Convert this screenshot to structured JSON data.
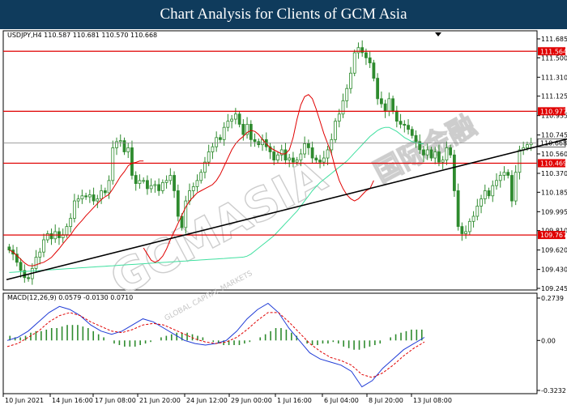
{
  "title": "Chart Analysis for Clients of GCM Asia",
  "watermark": {
    "brand": "GCMASIA",
    "sub": "GLOBAL CAPITAL MARKETS",
    "badge": "国际金融"
  },
  "colors": {
    "header_bg": "#0f3b5c",
    "candle": "#2e8b2e",
    "support_resistance": "#e00000",
    "trendline": "#000000",
    "ma_fast": "#e00000",
    "ma_slow": "#40e0a0",
    "macd_line": "#1f3bd6",
    "macd_signal": "#e00000",
    "macd_hist": "#2e8b2e",
    "current_line": "#808080"
  },
  "chart_data": [
    {
      "type": "candlestick",
      "info": "USDJPY,H4  110.587 110.681 110.570 110.668",
      "ylim": [
        109.245,
        111.685
      ],
      "y_ticks": [
        "111.685",
        "111.500",
        "111.310",
        "111.125",
        "110.935",
        "110.745",
        "110.560",
        "110.370",
        "110.185",
        "109.995",
        "109.810",
        "109.620",
        "109.430",
        "109.245"
      ],
      "x_ticks": [
        "10 Jun 2021",
        "14 Jun 16:00",
        "17 Jun 08:00",
        "21 Jun 20:00",
        "24 Jun 12:00",
        "29 Jun 00:00",
        "1 Jul 16:00",
        "6 Jul 04:00",
        "8 Jul 20:00",
        "13 Jul 08:00"
      ],
      "levels": [
        {
          "label": "111.564",
          "value": 111.564
        },
        {
          "label": "110.977",
          "value": 110.977
        },
        {
          "label": "110.469",
          "value": 110.469
        },
        {
          "label": "109.767",
          "value": 109.767
        }
      ],
      "current_price": {
        "label": "110.668",
        "value": 110.668
      },
      "closes": [
        109.62,
        109.58,
        109.5,
        109.42,
        109.35,
        109.34,
        109.44,
        109.55,
        109.6,
        109.72,
        109.78,
        109.73,
        109.8,
        109.74,
        109.77,
        109.85,
        109.93,
        110.1,
        110.12,
        110.15,
        110.14,
        110.16,
        110.1,
        110.12,
        110.2,
        110.18,
        110.3,
        110.62,
        110.68,
        110.69,
        110.58,
        110.62,
        110.35,
        110.27,
        110.3,
        110.3,
        110.22,
        110.25,
        110.26,
        110.2,
        110.28,
        110.3,
        110.35,
        110.2,
        109.95,
        109.84,
        110.1,
        110.2,
        110.24,
        110.3,
        110.38,
        110.48,
        110.58,
        110.63,
        110.72,
        110.7,
        110.82,
        110.88,
        110.9,
        110.95,
        110.85,
        110.75,
        110.85,
        110.7,
        110.68,
        110.65,
        110.7,
        110.63,
        110.58,
        110.5,
        110.55,
        110.6,
        110.5,
        110.52,
        110.48,
        110.5,
        110.56,
        110.66,
        110.62,
        110.52,
        110.5,
        110.48,
        110.52,
        110.6,
        110.7,
        110.88,
        110.95,
        111.08,
        111.2,
        111.35,
        111.55,
        111.6,
        111.55,
        111.5,
        111.45,
        111.3,
        111.1,
        111.05,
        110.98,
        111.1,
        110.98,
        110.88,
        110.85,
        110.84,
        110.8,
        110.74,
        110.68,
        110.6,
        110.55,
        110.6,
        110.52,
        110.58,
        110.48,
        110.5,
        110.62,
        110.55,
        110.2,
        109.85,
        109.78,
        109.8,
        109.9,
        109.95,
        110.05,
        110.12,
        110.2,
        110.15,
        110.25,
        110.3,
        110.35,
        110.38,
        110.35,
        110.1,
        110.38,
        110.6,
        110.62,
        110.65,
        110.668
      ],
      "ma_fast": [
        109.64,
        109.58,
        109.52,
        109.5,
        109.52,
        109.56,
        109.63,
        109.72,
        109.8,
        109.88,
        109.96,
        110.04,
        110.1,
        110.14,
        110.18,
        110.2,
        110.22,
        110.24,
        110.26,
        110.3,
        110.36,
        110.44,
        110.52,
        110.6,
        110.66,
        110.7,
        110.73,
        110.77,
        110.79,
        110.78,
        110.75,
        110.7,
        110.66,
        110.62,
        110.6,
        110.58,
        110.56,
        110.56,
        110.6,
        110.72,
        110.9,
        111.04,
        111.12,
        111.14,
        111.1,
        111.0,
        110.88,
        110.76,
        110.66,
        110.56,
        110.42,
        110.3,
        110.22,
        110.16,
        110.12,
        110.1,
        110.12,
        110.16,
        110.2,
        110.22,
        110.3
      ],
      "ma_fast_start_index": 35,
      "ma_slow": [
        109.55,
        109.56,
        109.58,
        109.61,
        109.64,
        109.67,
        109.7,
        109.73,
        109.76,
        109.8,
        109.84,
        109.88,
        109.92,
        109.96,
        110.0,
        110.05,
        110.1,
        110.15,
        110.2,
        110.24,
        110.28,
        110.31,
        110.34,
        110.37,
        110.4,
        110.43,
        110.46,
        110.49,
        110.53,
        110.57,
        110.61,
        110.65,
        110.69,
        110.73,
        110.76,
        110.79,
        110.81,
        110.82,
        110.82,
        110.8,
        110.78,
        110.75,
        110.72,
        110.7,
        110.68,
        110.67,
        110.66,
        110.66
      ],
      "ma_slow_start_index": 61,
      "trendline": [
        {
          "x": "10 Jun 2021",
          "y": 109.33
        },
        {
          "x": "13 Jul 08:00",
          "y": 110.57
        }
      ]
    },
    {
      "type": "macd",
      "label": "MACD(12,26,9) 0.0579 -0.0130 0.0710",
      "y_ticks": [
        "0.2739",
        "0.00",
        "-0.3232"
      ],
      "ylim": [
        -0.3232,
        0.2739
      ],
      "histogram": [
        0.03,
        0.02,
        0.02,
        0.03,
        0.05,
        0.06,
        0.06,
        0.07,
        0.08,
        0.08,
        0.09,
        0.1,
        0.1,
        0.1,
        0.09,
        0.08,
        0.06,
        0.04,
        0.02,
        0.0,
        -0.02,
        -0.03,
        -0.04,
        -0.04,
        -0.04,
        -0.03,
        -0.02,
        -0.01,
        0.0,
        0.02,
        0.03,
        0.04,
        0.05,
        0.05,
        0.05,
        0.04,
        0.03,
        0.02,
        0.0,
        -0.01,
        -0.02,
        -0.03,
        -0.03,
        -0.03,
        -0.03,
        -0.02,
        -0.01,
        0.0,
        0.02,
        0.04,
        0.06,
        0.08,
        0.08,
        0.07,
        0.05,
        0.03,
        0.0,
        -0.02,
        -0.03,
        -0.03,
        -0.02,
        -0.02,
        -0.01,
        -0.02,
        -0.04,
        -0.05,
        -0.06,
        -0.06,
        -0.05,
        -0.04,
        -0.03,
        -0.02,
        0.0,
        0.02,
        0.04,
        0.05,
        0.06,
        0.07,
        0.07,
        0.07
      ],
      "macd_line": [
        0.0,
        0.02,
        0.06,
        0.12,
        0.18,
        0.22,
        0.2,
        0.16,
        0.1,
        0.06,
        0.04,
        0.06,
        0.1,
        0.14,
        0.12,
        0.08,
        0.04,
        0.0,
        -0.02,
        -0.03,
        -0.02,
        0.0,
        0.06,
        0.14,
        0.2,
        0.24,
        0.18,
        0.08,
        0.0,
        -0.08,
        -0.12,
        -0.14,
        -0.16,
        -0.2,
        -0.3,
        -0.26,
        -0.18,
        -0.12,
        -0.06,
        -0.02,
        0.02
      ],
      "signal_line": [
        -0.04,
        -0.02,
        0.02,
        0.06,
        0.12,
        0.16,
        0.18,
        0.16,
        0.12,
        0.09,
        0.06,
        0.05,
        0.07,
        0.1,
        0.11,
        0.1,
        0.07,
        0.04,
        0.01,
        -0.01,
        -0.02,
        -0.01,
        0.02,
        0.07,
        0.13,
        0.18,
        0.18,
        0.12,
        0.05,
        -0.02,
        -0.07,
        -0.11,
        -0.13,
        -0.16,
        -0.22,
        -0.24,
        -0.21,
        -0.16,
        -0.1,
        -0.05,
        -0.01
      ]
    }
  ]
}
